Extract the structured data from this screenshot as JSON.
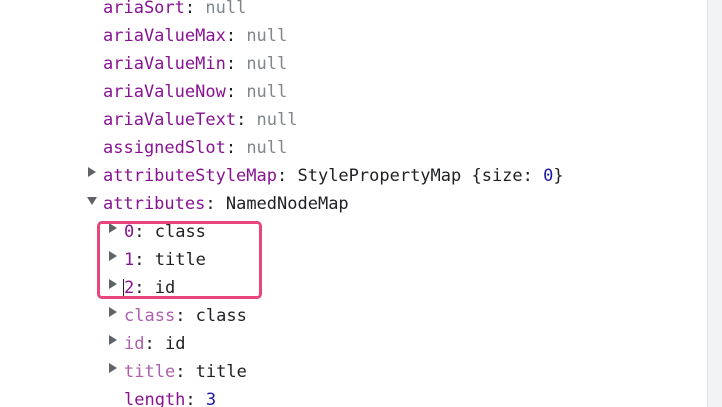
{
  "properties": [
    {
      "key": "ariaSort",
      "sep": ": ",
      "value": "null",
      "type": "null"
    },
    {
      "key": "ariaValueMax",
      "sep": ": ",
      "value": "null",
      "type": "null"
    },
    {
      "key": "ariaValueMin",
      "sep": ": ",
      "value": "null",
      "type": "null"
    },
    {
      "key": "ariaValueNow",
      "sep": ": ",
      "value": "null",
      "type": "null"
    },
    {
      "key": "ariaValueText",
      "sep": ": ",
      "value": "null",
      "type": "null"
    },
    {
      "key": "assignedSlot",
      "sep": ": ",
      "value": "null",
      "type": "null"
    }
  ],
  "attributeStyleMap": {
    "key": "attributeStyleMap",
    "sep": ": ",
    "value_prefix": "StylePropertyMap {size: ",
    "value_num": "0",
    "value_suffix": "}"
  },
  "attributes": {
    "key": "attributes",
    "sep": ": ",
    "value": "NamedNodeMap",
    "items": [
      {
        "key": "0",
        "sep": ": ",
        "value": "class"
      },
      {
        "key": "1",
        "sep": ": ",
        "value": "title"
      },
      {
        "key": "2",
        "sep": ": ",
        "value": "id"
      }
    ],
    "named": [
      {
        "key": "class",
        "sep": ": ",
        "value": "class"
      },
      {
        "key": "id",
        "sep": ": ",
        "value": "id"
      },
      {
        "key": "title",
        "sep": ": ",
        "value": "title"
      }
    ],
    "length": {
      "key": "length",
      "sep": ": ",
      "value": "3"
    }
  },
  "colors": {
    "property_key": "#881391",
    "light_key": "#ab5fac",
    "null_value": "#80868b",
    "number_value": "#1a1aa6",
    "highlight_border": "#e8457a"
  },
  "icons": {
    "collapsed": "triangle-right-icon",
    "expanded": "triangle-down-icon"
  }
}
